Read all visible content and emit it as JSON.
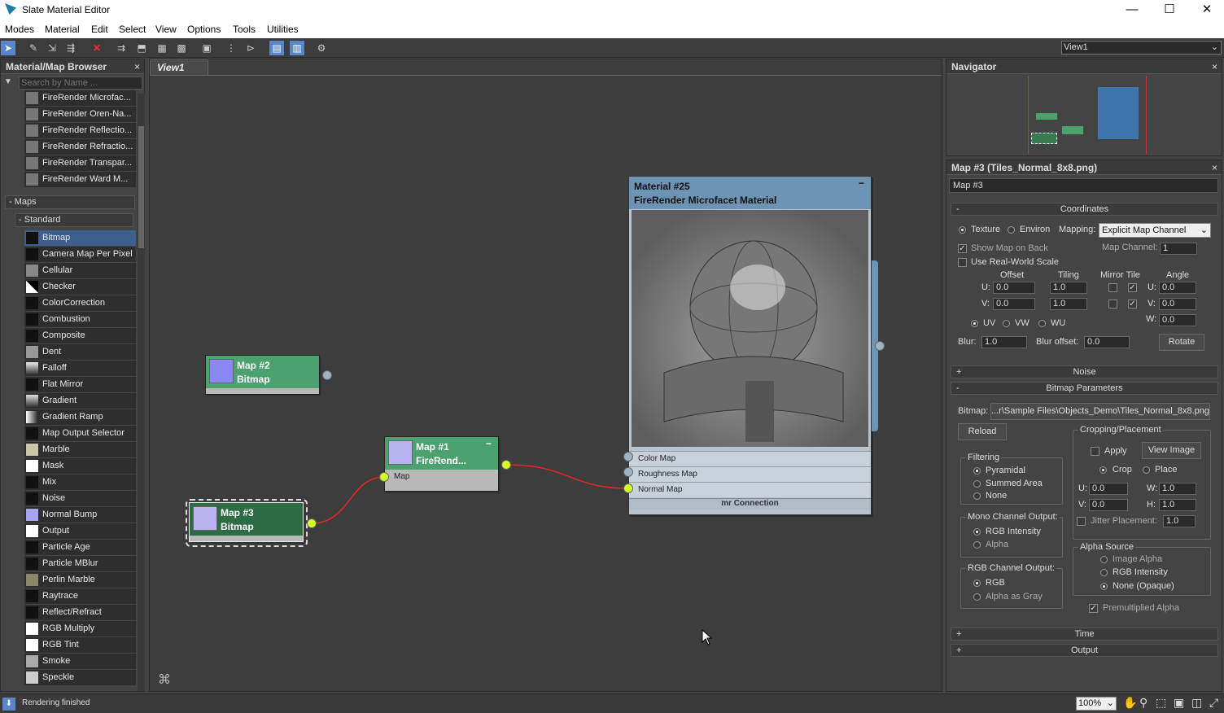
{
  "window": {
    "title": "Slate Material Editor",
    "minimize": "—",
    "maximize": "☐",
    "close": "✕"
  },
  "menu": [
    "Modes",
    "Material",
    "Edit",
    "Select",
    "View",
    "Options",
    "Tools",
    "Utilities"
  ],
  "toolbar": {
    "view_select": "View1"
  },
  "browser": {
    "title": "Material/Map Browser",
    "search_placeholder": "Search by Name ...",
    "top_items": [
      "FireRender Microfac...",
      "FireRender Oren-Na...",
      "FireRender Reflectio...",
      "FireRender Refractio...",
      "FireRender Transpar...",
      "FireRender Ward M..."
    ],
    "maps_label": "Maps",
    "standard_label": "Standard",
    "maps": [
      "Bitmap",
      "Camera Map Per Pixel",
      "Cellular",
      "Checker",
      "ColorCorrection",
      "Combustion",
      "Composite",
      "Dent",
      "Falloff",
      "Flat Mirror",
      "Gradient",
      "Gradient Ramp",
      "Map Output Selector",
      "Marble",
      "Mask",
      "Mix",
      "Noise",
      "Normal Bump",
      "Output",
      "Particle Age",
      "Particle MBlur",
      "Perlin Marble",
      "Raytrace",
      "Reflect/Refract",
      "RGB Multiply",
      "RGB Tint",
      "Smoke",
      "Speckle"
    ]
  },
  "view": {
    "tab": "View1"
  },
  "nodes": {
    "map2": {
      "title": "Map #2",
      "sub": "Bitmap"
    },
    "map1": {
      "title": "Map #1",
      "sub": "FireRend...",
      "port": "Map"
    },
    "map3": {
      "title": "Map #3",
      "sub": "Bitmap"
    },
    "material": {
      "title": "Material #25",
      "sub": "FireRender Microfacet Material",
      "ports": [
        "Color Map",
        "Roughness Map",
        "Normal Map"
      ],
      "footer": "mr Connection"
    }
  },
  "navigator": {
    "title": "Navigator"
  },
  "params": {
    "title": "Map #3 (Tiles_Normal_8x8.png)",
    "name": "Map #3",
    "coordinates": "Coordinates",
    "texture": "Texture",
    "environ": "Environ",
    "mapping_label": "Mapping:",
    "mapping": "Explicit Map Channel",
    "show_map": "Show Map on Back",
    "map_channel_label": "Map Channel:",
    "map_channel": "1",
    "real_world": "Use Real-World Scale",
    "offset": "Offset",
    "tiling": "Tiling",
    "mirror_tile": "Mirror Tile",
    "angle": "Angle",
    "u": "U:",
    "v": "V:",
    "w": "W:",
    "u_off": "0.0",
    "v_off": "0.0",
    "u_til": "1.0",
    "v_til": "1.0",
    "u_ang": "0.0",
    "v_ang": "0.0",
    "w_ang": "0.0",
    "uv": "UV",
    "vw": "VW",
    "wu": "WU",
    "blur_label": "Blur:",
    "blur": "1.0",
    "blur_off_label": "Blur offset:",
    "blur_off": "0.0",
    "rotate": "Rotate",
    "noise": "Noise",
    "bitmap_params": "Bitmap Parameters",
    "bitmap_label": "Bitmap:",
    "bitmap_path": "...r\\Sample Files\\Objects_Demo\\Tiles_Normal_8x8.png",
    "reload": "Reload",
    "cropping": "Cropping/Placement",
    "apply": "Apply",
    "view_image": "View Image",
    "crop": "Crop",
    "place": "Place",
    "cu": "0.0",
    "cv": "0.0",
    "cw": "1.0",
    "ch": "1.0",
    "h": "H:",
    "jitter": "Jitter Placement:",
    "jitter_val": "1.0",
    "filtering": "Filtering",
    "pyramidal": "Pyramidal",
    "summed": "Summed Area",
    "none": "None",
    "mono": "Mono Channel Output:",
    "rgb_int": "RGB Intensity",
    "alpha": "Alpha",
    "rgbout": "RGB Channel Output:",
    "rgb": "RGB",
    "alpha_gray": "Alpha as Gray",
    "alpha_src": "Alpha Source",
    "img_alpha": "Image Alpha",
    "rgb_int2": "RGB Intensity",
    "none_opaque": "None (Opaque)",
    "premult": "Premultiplied Alpha",
    "time": "Time",
    "output": "Output"
  },
  "status": {
    "text": "Rendering finished",
    "zoom": "100%"
  }
}
